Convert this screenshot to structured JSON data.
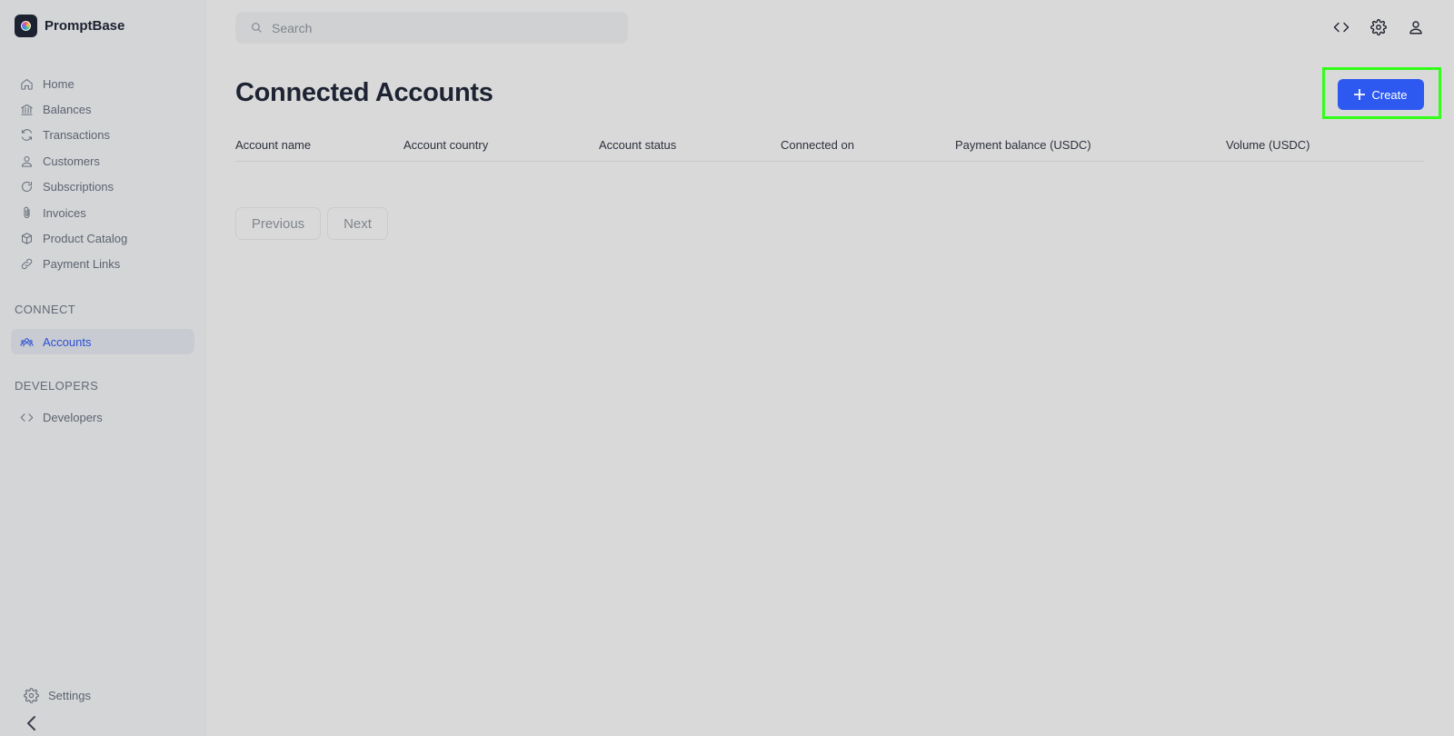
{
  "brand": {
    "name": "PromptBase"
  },
  "sidebar": {
    "items": [
      {
        "label": "Home",
        "icon": "home-icon"
      },
      {
        "label": "Balances",
        "icon": "bank-icon"
      },
      {
        "label": "Transactions",
        "icon": "refresh-icon"
      },
      {
        "label": "Customers",
        "icon": "user-icon"
      },
      {
        "label": "Subscriptions",
        "icon": "rotate-icon"
      },
      {
        "label": "Invoices",
        "icon": "paperclip-icon"
      },
      {
        "label": "Product Catalog",
        "icon": "box-icon"
      },
      {
        "label": "Payment Links",
        "icon": "link-icon"
      }
    ],
    "connect_section": "CONNECT",
    "accounts_label": "Accounts",
    "developers_section": "DEVELOPERS",
    "developers_label": "Developers",
    "settings_label": "Settings"
  },
  "search": {
    "placeholder": "Search"
  },
  "header": {
    "icons": [
      "code-icon",
      "gear-icon",
      "user-icon"
    ]
  },
  "main": {
    "title": "Connected Accounts",
    "create_label": "Create",
    "columns": [
      "Account name",
      "Account country",
      "Account status",
      "Connected on",
      "Payment balance (USDC)",
      "Volume (USDC)"
    ],
    "rows": [],
    "previous_label": "Previous",
    "next_label": "Next"
  },
  "colors": {
    "accent": "#2e59f0",
    "active_nav": "#2b4fd6",
    "highlight": "#31ff17"
  }
}
